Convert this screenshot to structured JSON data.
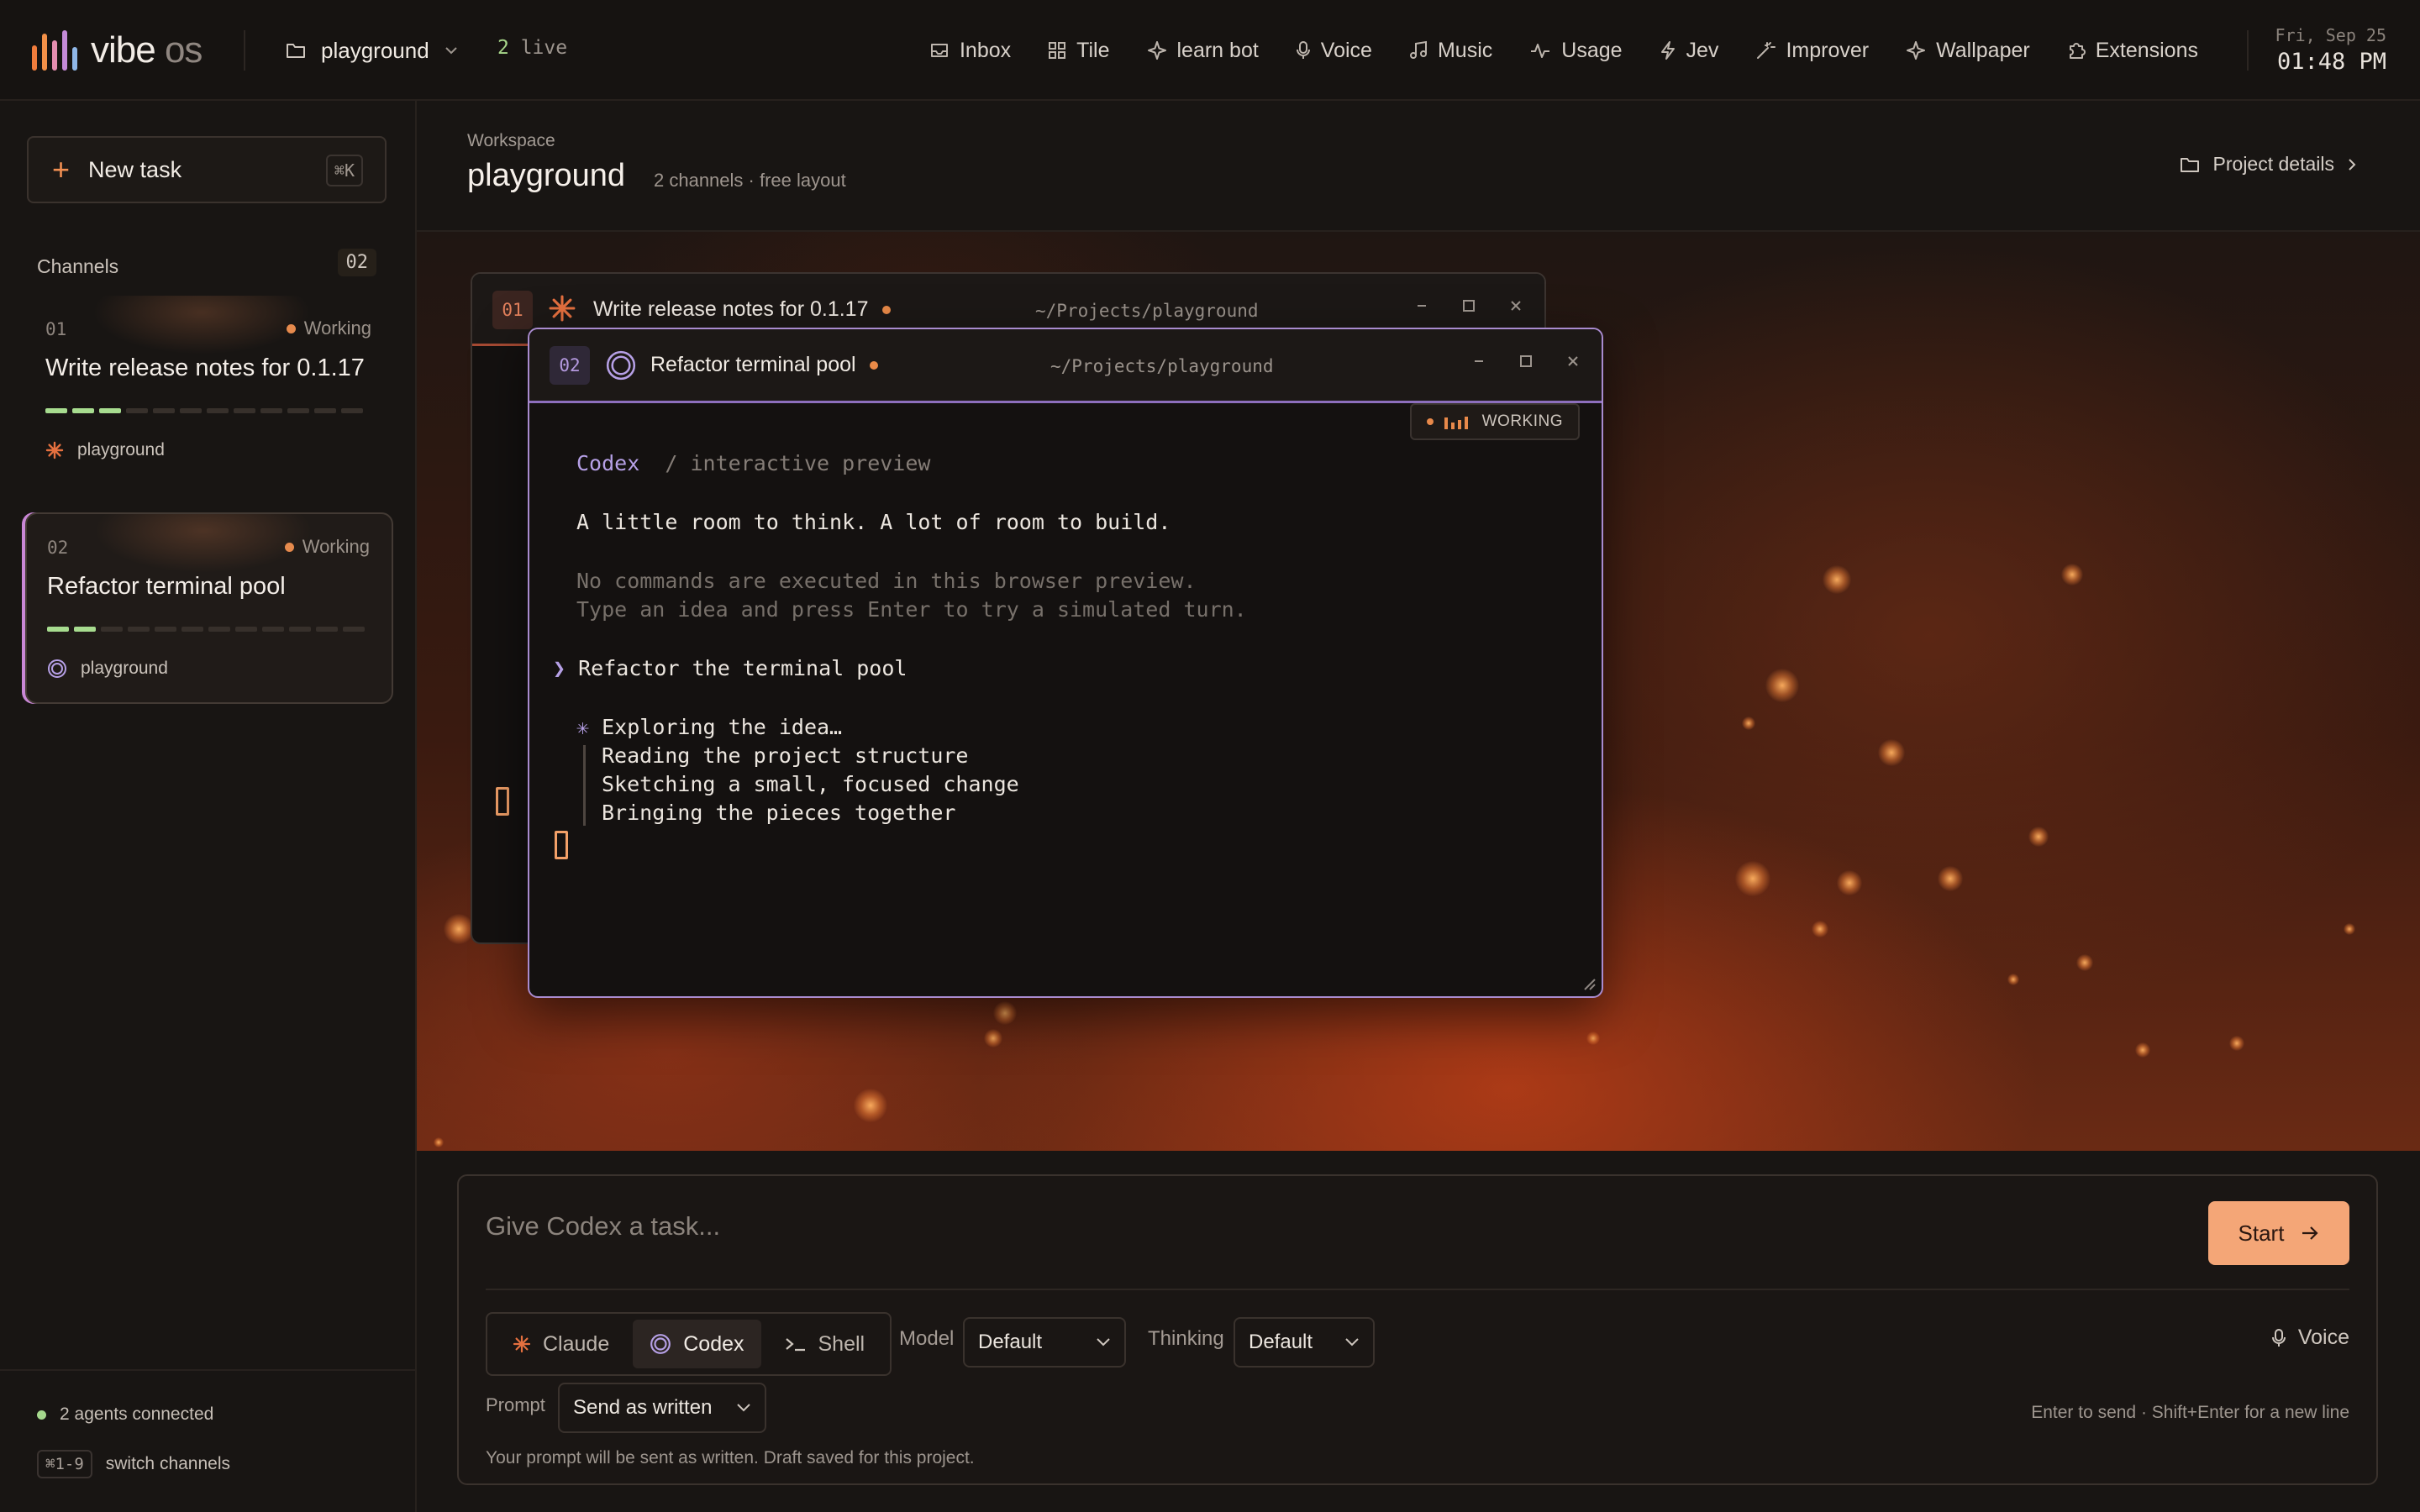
{
  "app": {
    "logo_primary": "vibe",
    "logo_secondary": "os"
  },
  "topbar": {
    "project": "playground",
    "live_count": "2",
    "live_label": " live",
    "nav": [
      "Inbox",
      "Tile",
      "learn bot",
      "Voice",
      "Music",
      "Usage",
      "Jev",
      "Improver",
      "Wallpaper",
      "Extensions"
    ],
    "date": "Fri, Sep 25",
    "time": "01:48 PM"
  },
  "sidebar": {
    "new_task": "New task",
    "new_task_shortcut": "⌘K",
    "channels_label": "Channels",
    "channels_count": "02",
    "channels": [
      {
        "num": "01",
        "status": "Working",
        "title": "Write release notes for 0.1.17",
        "project": "playground",
        "progress": 3,
        "steps": 12,
        "agent_icon": "claude-asterisk-icon"
      },
      {
        "num": "02",
        "status": "Working",
        "title": "Refactor terminal pool",
        "project": "playground",
        "progress": 2,
        "steps": 12,
        "agent_icon": "codex-ring-icon"
      }
    ],
    "footer_connected": "2 agents connected",
    "footer_shortcut": "⌘1-9",
    "footer_switch": "switch channels"
  },
  "header": {
    "label": "Workspace",
    "title": "playground",
    "meta": "2 channels · free layout",
    "project_details": "Project details"
  },
  "windows": {
    "back": {
      "num": "01",
      "title": "Write release notes for 0.1.17",
      "path": "~/Projects/playground"
    },
    "front": {
      "num": "02",
      "title": "Refactor terminal pool",
      "path": "~/Projects/playground",
      "badge": "WORKING",
      "codex_label": "Codex",
      "codex_sub": "/ interactive preview",
      "tagline": "A little room to think. A lot of room to build.",
      "note1": "No commands are executed in this browser preview.",
      "note2": "Type an idea and press Enter to try a simulated turn.",
      "prompt_symbol": "❯",
      "prompt": "Refactor the terminal pool",
      "spark": "✳",
      "explore": "Exploring the idea…",
      "steps": [
        "Reading the project structure",
        "Sketching a small, focused change",
        "Bringing the pieces together"
      ]
    }
  },
  "composer": {
    "placeholder": "Give Codex a task...",
    "start": "Start",
    "agents": [
      "Claude",
      "Codex",
      "Shell"
    ],
    "selected_agent": "Codex",
    "model_label": "Model",
    "model_value": "Default",
    "thinking_label": "Thinking",
    "thinking_value": "Default",
    "voice": "Voice",
    "prompt_label": "Prompt",
    "prompt_value": "Send as written",
    "hint": "Enter to send · Shift+Enter for a new line",
    "note": "Your prompt will be sent as written. Draft saved for this project."
  },
  "colors": {
    "accent": "#f4a677",
    "codex": "#b6a0e6",
    "claude": "#e5703f",
    "working": "#e8894a",
    "progress": "#a7dc8f"
  }
}
